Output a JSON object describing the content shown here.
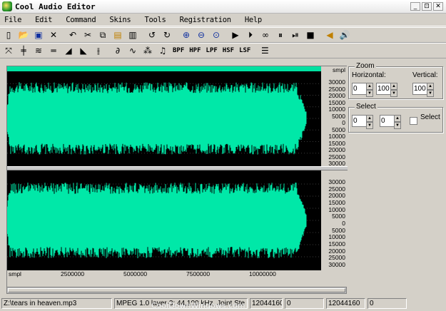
{
  "window": {
    "title": "Cool Audio Editor",
    "controls": [
      "_",
      "⊡",
      "✕"
    ]
  },
  "menu": [
    "File",
    "Edit",
    "Command",
    "Skins",
    "Tools",
    "Registration",
    "Help"
  ],
  "toolbar1": [
    "new-icon",
    "open-icon",
    "save-icon",
    "close-file-icon",
    "undo-icon",
    "cut-icon",
    "copy-icon",
    "paste-icon",
    "trash-icon",
    "undo-arrow-icon",
    "redo-arrow-icon",
    "zoom-in-icon",
    "zoom-out-icon",
    "zoom-fit-icon",
    "play-icon",
    "play-from-icon",
    "loop-icon",
    "pause-icon",
    "step-icon",
    "stop-icon",
    "speaker-left-icon",
    "speaker-right-icon"
  ],
  "toolbar2_text": [
    "BPF",
    "HPF",
    "LPF",
    "HSF",
    "LSF"
  ],
  "waveform": {
    "channel_label": "smpl",
    "scale_labels": [
      "30000",
      "25000",
      "20000",
      "15000",
      "10000",
      "5000",
      "0",
      "5000",
      "10000",
      "15000",
      "20000",
      "25000",
      "30000"
    ],
    "time_unit": "smpl",
    "time_ticks": [
      "2500000",
      "5000000",
      "7500000",
      "10000000"
    ],
    "wave_color": "#00e8a8"
  },
  "zoom": {
    "group": "Zoom",
    "horizontal_label": "Horizontal:",
    "vertical_label": "Vertical:",
    "h_from": "0",
    "h_to": "100",
    "v_value": "100"
  },
  "select": {
    "group": "Select",
    "from": "0",
    "to": "0",
    "checkbox_label": "Select"
  },
  "status": {
    "file": "Z:\\tears in heaven.mp3",
    "format": "MPEG 1.0 layer-3: 44,100 kHz, Joint Ste",
    "length": "12044160",
    "sel_start": "0",
    "sel_end": "12044160",
    "sel_len": "0"
  },
  "watermark": "CoolDownWindows.com"
}
